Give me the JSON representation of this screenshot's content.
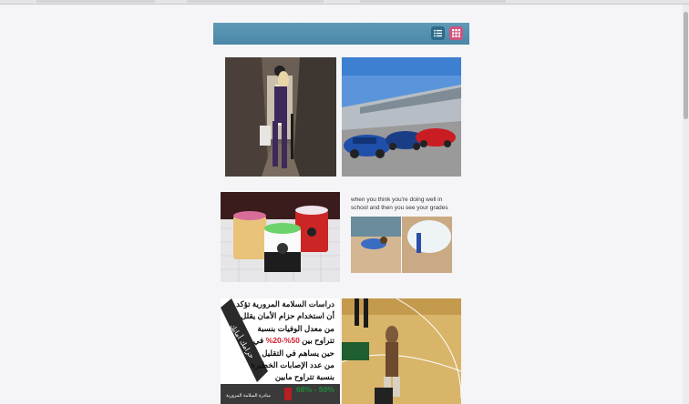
{
  "toolbar": {
    "list_view_icon": "list-icon",
    "grid_view_icon": "grid-icon",
    "accent": "#4a86a6",
    "active_color": "#d0557e"
  },
  "gallery": {
    "items": [
      {
        "name": "photo-hallway-model"
      },
      {
        "name": "photo-red-blue-sports-cars"
      },
      {
        "name": "photo-enamel-mugs"
      },
      {
        "name": "meme-grades",
        "caption": "when you think you're doing well in school and then you see your grades"
      },
      {
        "name": "poster-road-safety",
        "lines": [
          "دراسات السلامة المرورية تؤكد",
          "أن استخدام حزام الأمان يقلل",
          "من معدل الوفيات بنسبة",
          "تتراوح بين",
          "50%-20%",
          "في",
          "حين يساهم في التقليل",
          "من عدد الإصابات الخطيرة",
          "بنسبة تتراوح مابين",
          "50% - 68%"
        ],
        "ribbon": "حزامك أمانك",
        "brand": "مبادرة السلامة المرورية"
      },
      {
        "name": "photo-basketball-mascot"
      }
    ]
  }
}
